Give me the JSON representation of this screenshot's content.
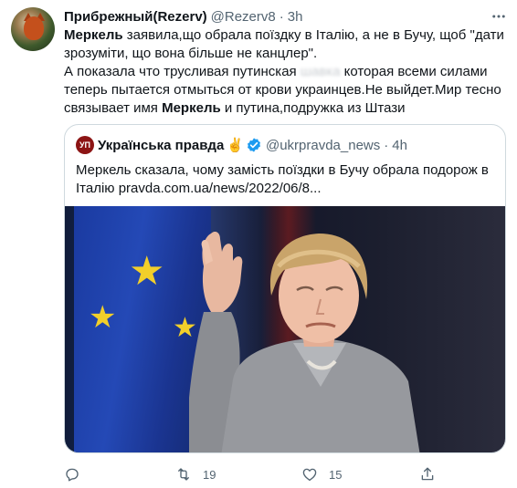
{
  "tweet": {
    "display_name": "Прибрежный(Rezerv)",
    "handle": "@Rezerv8",
    "separator": "·",
    "time": "3h",
    "body": {
      "line1_bold": "Меркель",
      "line1_rest": " заявила,що обрала поїздку в Італію, а не в Бучу, щоб \"дати",
      "line2": "зрозуміти, що вона більше не канцлер\".",
      "line3_a": "А показала что трусливая путинская ",
      "line3_blur": "шавка",
      "line3_b": " которая всеми силами",
      "line4": "теперь пытается отмыться от крови украинцев.Не выйдет.Мир тесно",
      "line5_a": "связывает имя ",
      "line5_bold": "Меркель",
      "line5_b": " и путина,подружка из Штази"
    },
    "quote": {
      "logo_text": "УП",
      "name": "Українська правда",
      "emoji": "✌",
      "handle": "@ukrpravda_news",
      "separator": "·",
      "time": "4h",
      "text_line1": "Меркель сказала, чому замість поїздки в Бучу обрала подорож в",
      "text_line2": "Італію pravda.com.ua/news/2022/06/8..."
    },
    "actions": {
      "reply": {
        "icon": "reply-icon",
        "count": ""
      },
      "retweet": {
        "icon": "retweet-icon",
        "count": "19"
      },
      "like": {
        "icon": "heart-icon",
        "count": "15"
      },
      "share": {
        "icon": "share-icon",
        "count": ""
      }
    },
    "colors": {
      "text": "#0f1419",
      "secondary": "#536471",
      "verified": "#1d9bf0",
      "border": "#cfd9de"
    }
  }
}
